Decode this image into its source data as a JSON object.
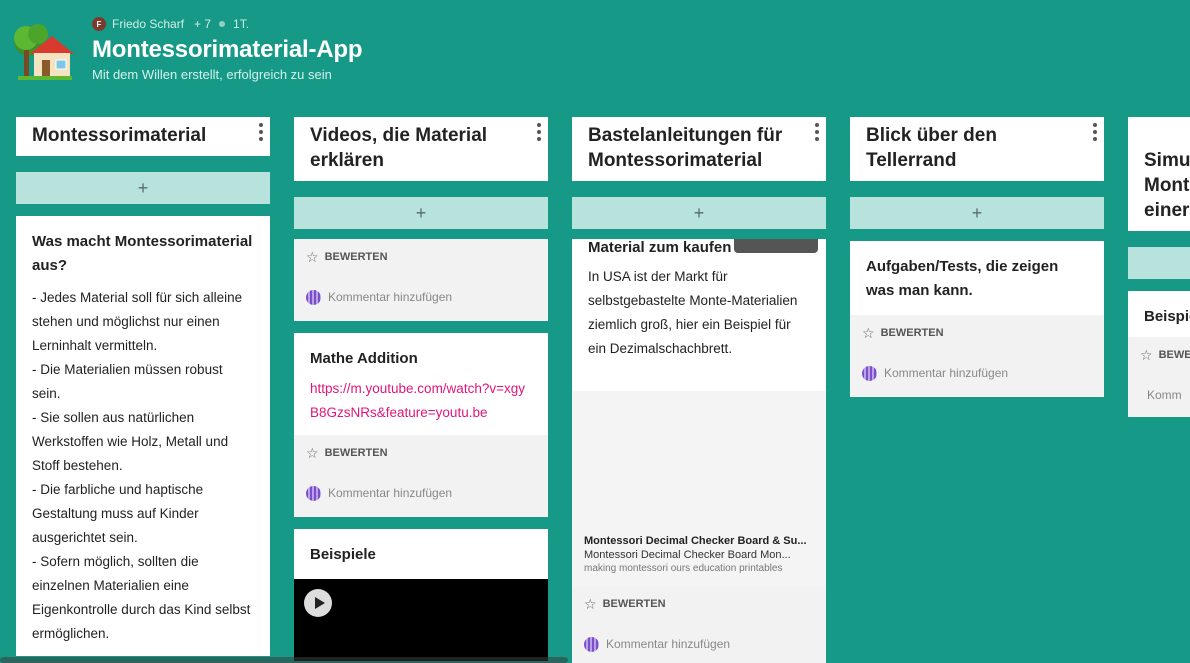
{
  "header": {
    "author_initial": "F",
    "author": "Friedo Scharf",
    "collaborators": "+ 7",
    "age": "1T.",
    "title": "Montessorimaterial-App",
    "subtitle": "Mit dem Willen erstellt, erfolgreich zu sein",
    "logo_icon": "house-tree-icon"
  },
  "common": {
    "add": "+",
    "rate": "BEWERTEN",
    "comment": "Kommentar hinzufügen"
  },
  "columns": [
    {
      "title": "Montessorimaterial",
      "cards": [
        {
          "title": "Was macht Montessorimaterial aus?",
          "lines": [
            "- Jedes Material soll für sich alleine stehen und möglichst nur einen Lerninhalt vermitteln.",
            " - Die Materialien müssen robust sein.",
            " - Sie sollen aus natürlichen Werkstoffen wie Holz, Metall und Stoff bestehen.",
            " - Die farbliche und haptische Gestaltung muss auf Kinder ausgerichtet sein.",
            " - Sofern möglich, sollten die einzelnen Materialien eine Eigenkontrolle durch das Kind selbst ermöglichen."
          ]
        }
      ]
    },
    {
      "title": "Videos, die Material erklären",
      "cards": [
        {
          "title": "Mathe Addition",
          "link": "https://m.youtube.com/watch?v=xgyB8GzsNRs&feature=youtu.be"
        },
        {
          "title": "Beispiele"
        }
      ]
    },
    {
      "title": "Bastelanleitungen für Montessorimaterial",
      "cards": [
        {
          "title": "Material zum kaufen",
          "body": "In USA ist der Markt für selbstgebastelte Monte-Materialien ziemlich groß, hier ein Beispiel für ein Dezimalschachbrett.",
          "preview_title": "Montessori Decimal Checker Board & Su...",
          "preview_desc": "Montessori Decimal Checker Board Mon...",
          "preview_source": "making montessori ours education printables"
        }
      ]
    },
    {
      "title": "Blick über den Tellerrand",
      "cards": [
        {
          "title": "Aufgaben/Tests, die zeigen was man kann."
        }
      ]
    },
    {
      "title": "Simu Mont einer",
      "cards": [
        {
          "title": "Beispie"
        }
      ],
      "rate_partial": "BEWE",
      "comment_partial": "Komm"
    }
  ]
}
